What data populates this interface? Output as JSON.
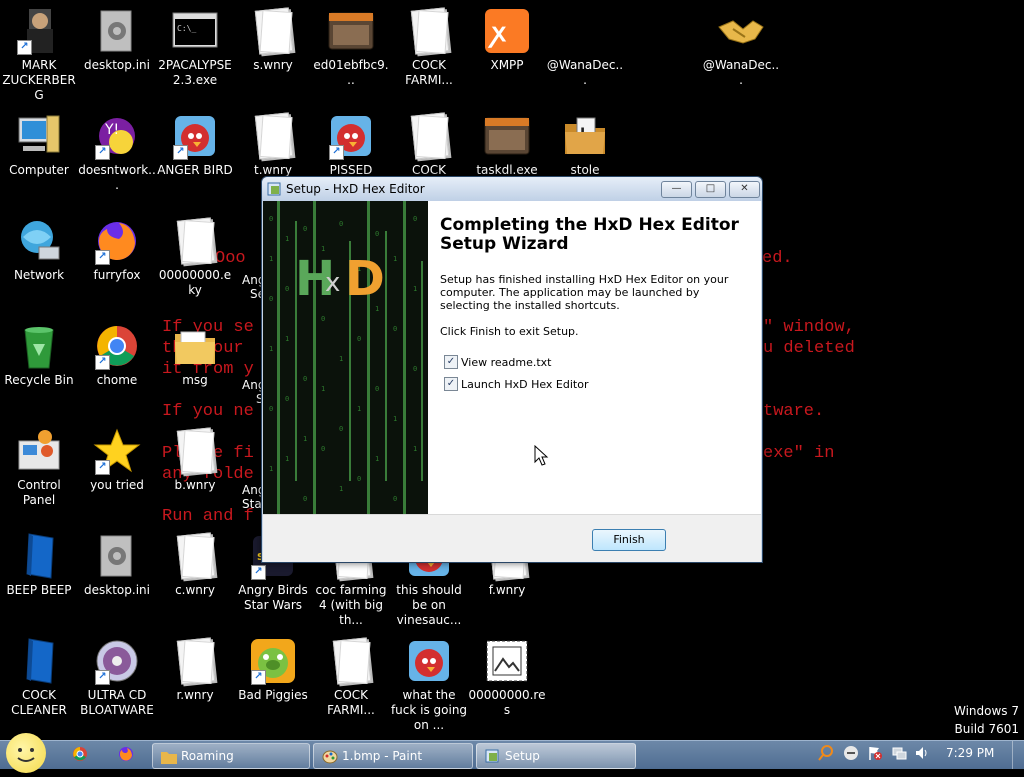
{
  "desktop": {
    "background_text": [
      "Ooo",
      "ed.",
      "If you se",
      "\" window,",
      "th  your",
      "u deleted",
      "it from y",
      "If you ne",
      "tware.",
      "Pl  se fi",
      "exe\" in",
      "any folde",
      "Run and f"
    ],
    "icons": [
      {
        "label": "MARK ZUCKERBERG",
        "icon": "person-icon"
      },
      {
        "label": "desktop.ini",
        "icon": "settings-file-icon"
      },
      {
        "label": "2PACALYPSE 2.3.exe",
        "icon": "console-icon"
      },
      {
        "label": "s.wnry",
        "icon": "blank-file-icon"
      },
      {
        "label": "ed01ebfbc9...",
        "icon": "window-app-icon"
      },
      {
        "label": "COCK FARMI...",
        "icon": "blank-file-icon"
      },
      {
        "label": "XMPP",
        "icon": "xampp-icon"
      },
      {
        "label": "@WanaDec...",
        "icon": "blank-icon"
      },
      {
        "label": "@WanaDec...",
        "icon": "handshake-icon"
      },
      {
        "label": "Computer",
        "icon": "computer-icon"
      },
      {
        "label": "doesntwork...",
        "icon": "yahoo-icon"
      },
      {
        "label": "ANGER BIRD",
        "icon": "angry-bird-icon"
      },
      {
        "label": "t.wnry",
        "icon": "blank-file-icon"
      },
      {
        "label": "PISSED BIRDS",
        "icon": "angry-bird-icon"
      },
      {
        "label": "COCK",
        "icon": "blank-file-icon"
      },
      {
        "label": "taskdl.exe",
        "icon": "window-app-icon"
      },
      {
        "label": "stole",
        "icon": "folder-icon"
      },
      {
        "label": "Network",
        "icon": "network-icon"
      },
      {
        "label": "furryfox",
        "icon": "firefox-icon"
      },
      {
        "label": "00000000.eky",
        "icon": "blank-file-icon"
      },
      {
        "label": "Recycle Bin",
        "icon": "recycle-bin-icon"
      },
      {
        "label": "chome",
        "icon": "chrome-icon"
      },
      {
        "label": "msg",
        "icon": "folder-icon"
      },
      {
        "label": "Control Panel",
        "icon": "control-panel-icon"
      },
      {
        "label": "you tried",
        "icon": "star-icon"
      },
      {
        "label": "b.wnry",
        "icon": "blank-file-icon"
      },
      {
        "label": "BEEP BEEP",
        "icon": "blue-book-icon"
      },
      {
        "label": "desktop.ini",
        "icon": "settings-file-icon"
      },
      {
        "label": "c.wnry",
        "icon": "blank-file-icon"
      },
      {
        "label": "Angry Birds Star Wars",
        "icon": "angry-birds-star-wars-icon"
      },
      {
        "label": "coc farming 4 (with big th...",
        "icon": "blank-file-icon"
      },
      {
        "label": "this should be on vinesauc...",
        "icon": "angry-bird-icon"
      },
      {
        "label": "f.wnry",
        "icon": "blank-file-icon"
      },
      {
        "label": "COCK CLEANER",
        "icon": "blue-book-icon"
      },
      {
        "label": "ULTRA CD BLOATWARE",
        "icon": "cd-icon"
      },
      {
        "label": "r.wnry",
        "icon": "blank-file-icon"
      },
      {
        "label": "Bad Piggies",
        "icon": "bad-piggies-icon"
      },
      {
        "label": "COCK FARMI...",
        "icon": "blank-file-icon"
      },
      {
        "label": "what the fuck is going on ...",
        "icon": "angry-bird-icon"
      },
      {
        "label": "00000000.res",
        "icon": "image-file-icon"
      }
    ],
    "partial_labels": [
      "Ang",
      "Se",
      "Ang",
      "S",
      "Ang",
      "Sta"
    ]
  },
  "window": {
    "title": "Setup - HxD Hex Editor",
    "logo_text": "HxD",
    "heading": "Completing the HxD Hex Editor Setup Wizard",
    "para1": "Setup has finished installing HxD Hex Editor on your computer. The application may be launched by selecting the installed shortcuts.",
    "para2": "Click Finish to exit Setup.",
    "checkboxes": [
      {
        "label": "View readme.txt",
        "checked": true
      },
      {
        "label": "Launch HxD Hex Editor",
        "checked": true
      }
    ],
    "finish_label": "Finish",
    "controls": {
      "minimize": "—",
      "maximize": "□",
      "close": "✕"
    }
  },
  "taskbar": {
    "buttons": [
      {
        "label": "Roaming",
        "icon": "folder-icon"
      },
      {
        "label": "1.bmp - Paint",
        "icon": "paint-icon"
      },
      {
        "label": "Setup",
        "icon": "setup-icon"
      }
    ],
    "pinned": [
      "chrome-icon",
      "firefox-icon"
    ],
    "clock": "7:29 PM",
    "watermark_line1": "Windows 7",
    "watermark_line2": "Build 7601"
  },
  "colors": {
    "bg_text": "#c8181e",
    "taskbar": "#5a7699",
    "window_frame": "#c9d7e8"
  }
}
